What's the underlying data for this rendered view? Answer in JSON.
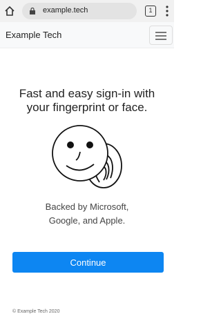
{
  "browser": {
    "url": "example.tech",
    "tab_count": "1",
    "home_icon": "home-icon",
    "lock_icon": "lock-icon",
    "menu_icon": "vertical-dots-icon"
  },
  "site": {
    "brand": "Example Tech",
    "menu_icon": "hamburger-icon"
  },
  "main": {
    "headline_line1": "Fast and easy sign-in with",
    "headline_line2": "your fingerprint or face.",
    "illustration_icon": "face-fingerprint-icon",
    "subtext_line1": "Backed by Microsoft,",
    "subtext_line2": "Google, and Apple.",
    "continue_label": "Continue",
    "accent_color": "#0d86f2"
  },
  "footer": {
    "copyright": "© Example Tech 2020"
  }
}
